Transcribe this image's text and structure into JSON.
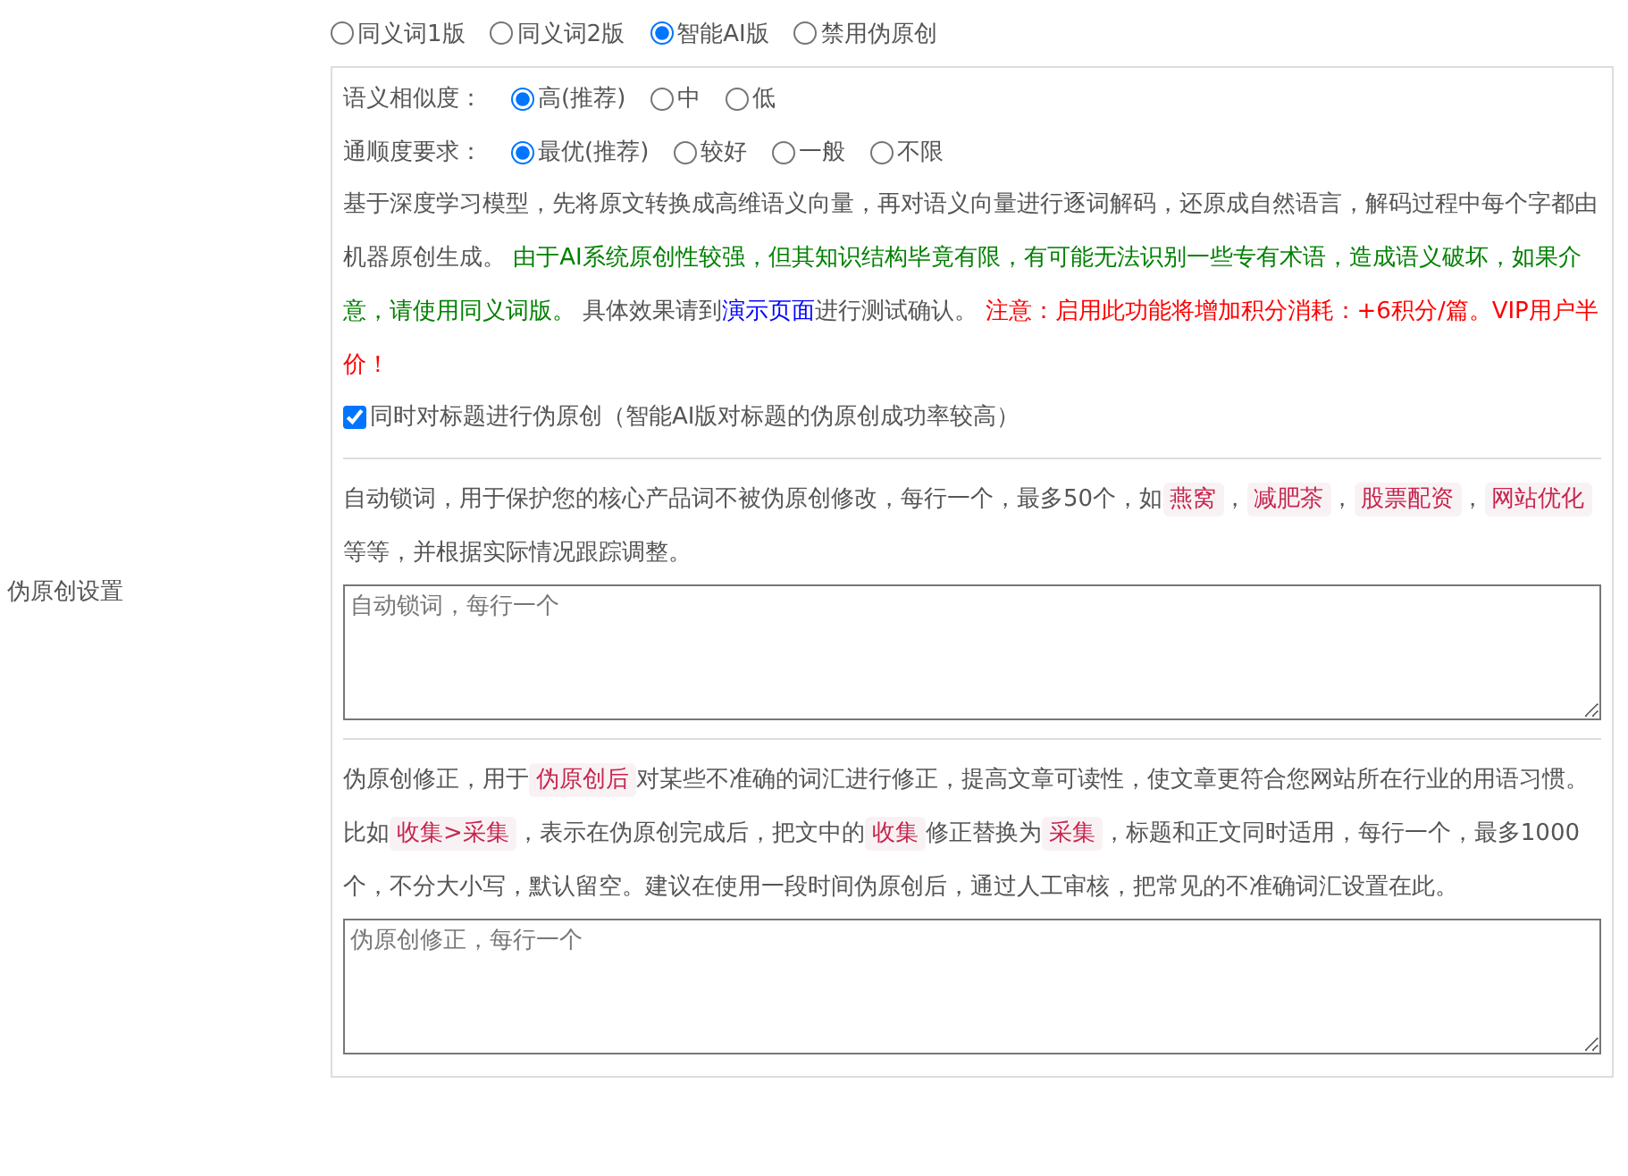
{
  "sidebar_label": "伪原创设置",
  "modes": [
    {
      "label": "同义词1版",
      "selected": false
    },
    {
      "label": "同义词2版",
      "selected": false
    },
    {
      "label": "智能AI版",
      "selected": true
    },
    {
      "label": "禁用伪原创",
      "selected": false
    }
  ],
  "similarity": {
    "label": "语义相似度：",
    "options": [
      {
        "label": "高(推荐)",
        "selected": true
      },
      {
        "label": "中",
        "selected": false
      },
      {
        "label": "低",
        "selected": false
      }
    ]
  },
  "fluency": {
    "label": "通顺度要求：",
    "options": [
      {
        "label": "最优(推荐)",
        "selected": true
      },
      {
        "label": "较好",
        "selected": false
      },
      {
        "label": "一般",
        "selected": false
      },
      {
        "label": "不限",
        "selected": false
      }
    ]
  },
  "ai_description": [
    {
      "kind": "text",
      "text": "基于深度学习模型，先将原文转换成高维语义向量，再对语义向量进行逐词解码，还原成自然语言，解码过程中每个字都由机器原创生成。 "
    },
    {
      "kind": "notice",
      "text": "由于AI系统原创性较强，但其知识结构毕竟有限，有可能无法识别一些专有术语，造成语义破坏，如果介意，请使用同义词版。"
    },
    {
      "kind": "text",
      "text": " 具体效果请到"
    },
    {
      "kind": "link",
      "text": "演示页面"
    },
    {
      "kind": "text",
      "text": "进行测试确认。 "
    },
    {
      "kind": "warning",
      "text": "注意：启用此功能将增加积分消耗：+6积分/篇。VIP用户半价！"
    }
  ],
  "title_option": {
    "label": "同时对标题进行伪原创（智能AI版对标题的伪原创成功率较高）",
    "checked": true
  },
  "lock_words": {
    "description": [
      {
        "kind": "text",
        "text": "自动锁词，用于保护您的核心产品词不被伪原创修改，每行一个，最多50个，如"
      },
      {
        "kind": "tag",
        "text": "燕窝"
      },
      {
        "kind": "text",
        "text": "，"
      },
      {
        "kind": "tag",
        "text": "减肥茶"
      },
      {
        "kind": "text",
        "text": "，"
      },
      {
        "kind": "tag",
        "text": "股票配资"
      },
      {
        "kind": "text",
        "text": "，"
      },
      {
        "kind": "tag",
        "text": "网站优化"
      },
      {
        "kind": "text",
        "text": " 等等，并根据实际情况跟踪调整。"
      }
    ],
    "placeholder": "自动锁词，每行一个"
  },
  "corrections": {
    "description": [
      {
        "kind": "text",
        "text": "伪原创修正，用于"
      },
      {
        "kind": "tag",
        "text": "伪原创后"
      },
      {
        "kind": "text",
        "text": "对某些不准确的词汇进行修正，提高文章可读性，使文章更符合您网站所在行业的用语习惯。比如"
      },
      {
        "kind": "tag",
        "text": "收集>采集"
      },
      {
        "kind": "text",
        "text": "，表示在伪原创完成后，把文中的"
      },
      {
        "kind": "tag",
        "text": "收集"
      },
      {
        "kind": "text",
        "text": "修正替换为"
      },
      {
        "kind": "tag",
        "text": "采集"
      },
      {
        "kind": "text",
        "text": "，标题和正文同时适用，每行一个，最多1000个，不分大小写，默认留空。建议在使用一段时间伪原创后，通过人工审核，把常见的不准确词汇设置在此。"
      }
    ],
    "placeholder": "伪原创修正，每行一个"
  }
}
